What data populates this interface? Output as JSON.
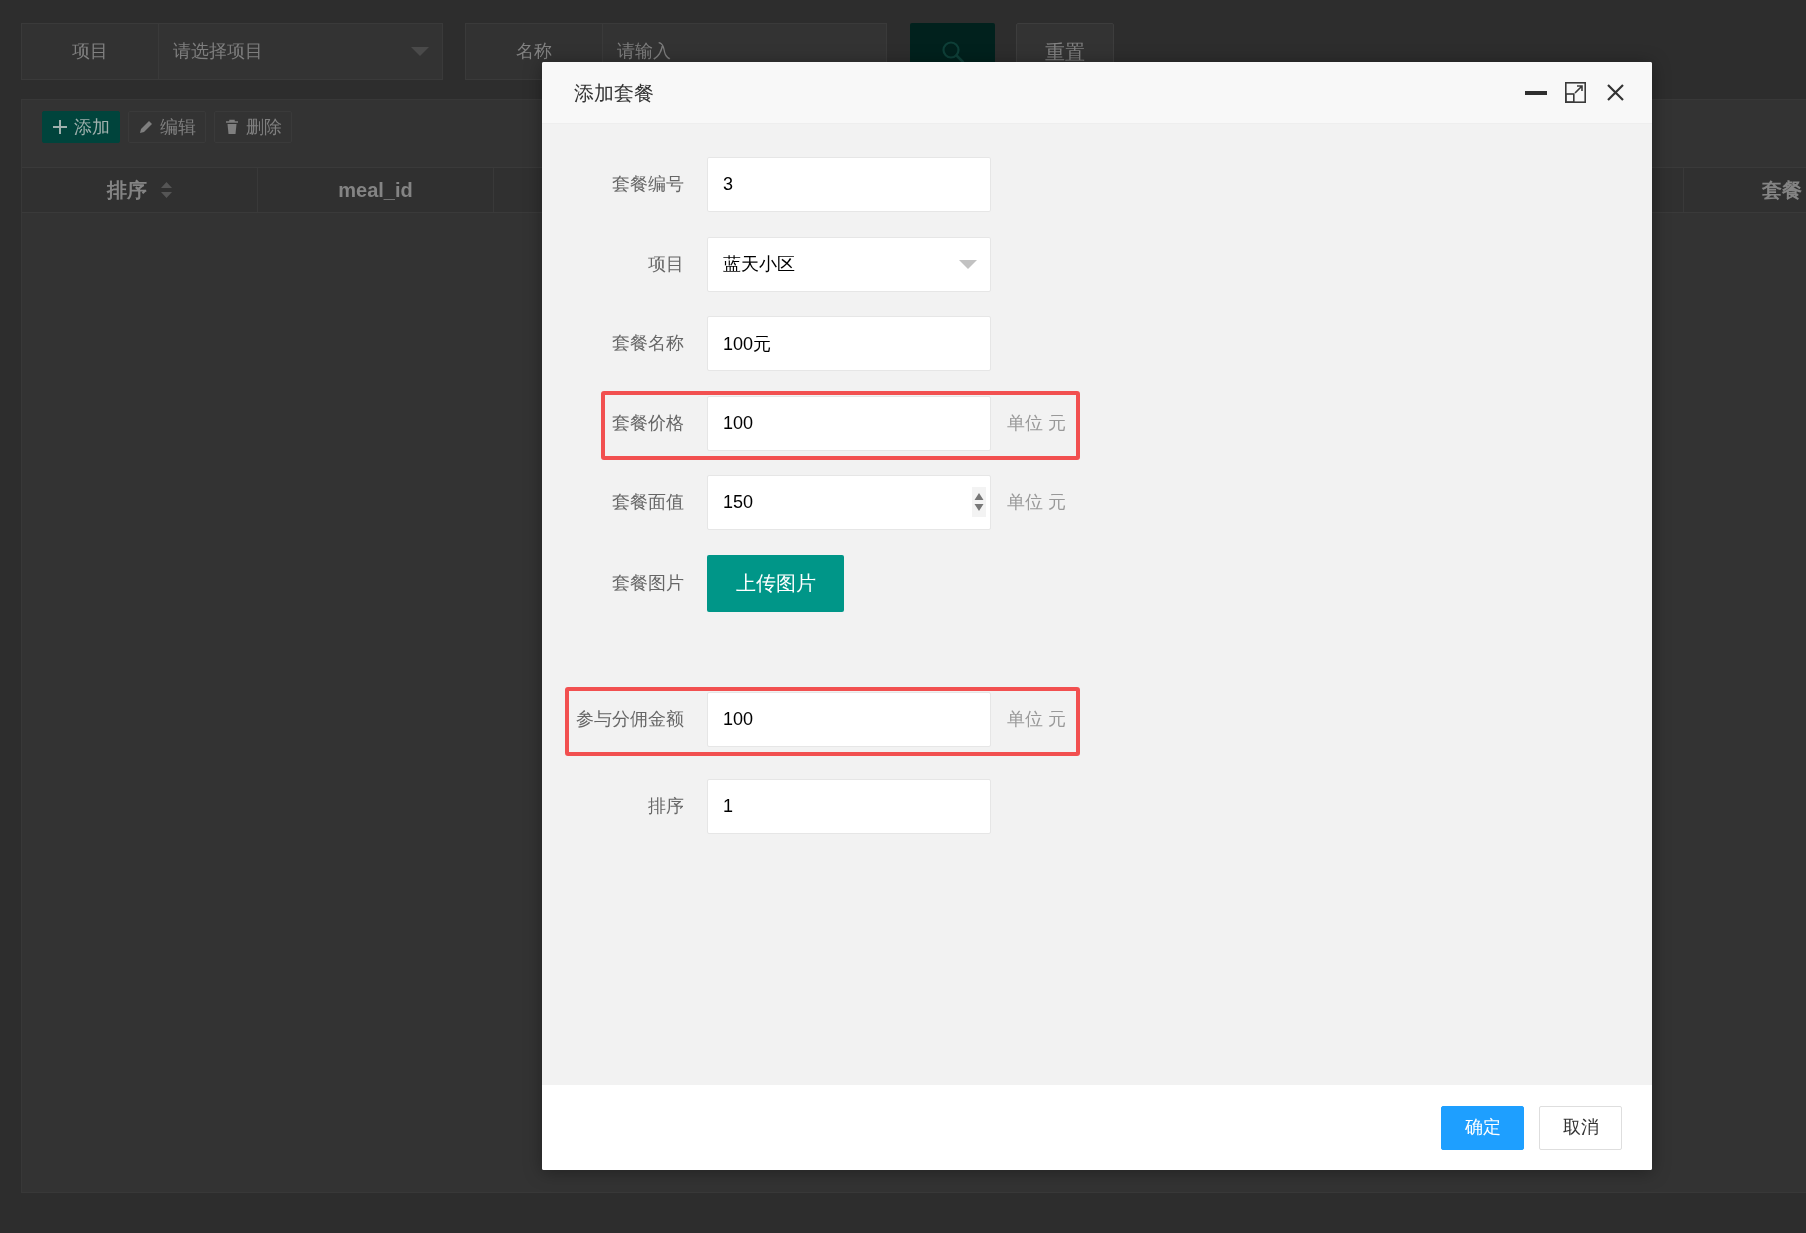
{
  "background_page": {
    "filters": [
      {
        "label": "项目",
        "kind": "select",
        "placeholder": "请选择项目"
      },
      {
        "label": "名称",
        "kind": "input",
        "placeholder": "请输入"
      }
    ],
    "reset_button": "重置",
    "toolbar": [
      {
        "kind": "add",
        "label": "添加",
        "disabled": false
      },
      {
        "kind": "edit",
        "label": "编辑",
        "disabled": true
      },
      {
        "kind": "delete",
        "label": "删除",
        "disabled": true
      }
    ],
    "table": {
      "columns": [
        {
          "label": "排序",
          "sortable": true
        },
        {
          "label": "meal_id",
          "sortable": false
        },
        {
          "label": "套餐",
          "sortable": false
        }
      ]
    }
  },
  "dialog": {
    "title": "添加套餐",
    "fields": [
      {
        "label": "套餐编号",
        "kind": "text",
        "value": "3",
        "highlighted": false
      },
      {
        "label": "项目",
        "kind": "select",
        "value": "蓝天小区",
        "highlighted": false
      },
      {
        "label": "套餐名称",
        "kind": "text",
        "value": "100元",
        "highlighted": false
      },
      {
        "label": "套餐价格",
        "kind": "text",
        "value": "100",
        "unit": "单位 元",
        "highlighted": true
      },
      {
        "label": "套餐面值",
        "kind": "number",
        "value": "150",
        "unit": "单位 元",
        "highlighted": false
      },
      {
        "label": "套餐图片",
        "kind": "upload",
        "button": "上传图片",
        "highlighted": false
      },
      {
        "label": "参与分佣金额",
        "kind": "text",
        "value": "100",
        "unit": "单位 元",
        "highlighted": true
      },
      {
        "label": "排序",
        "kind": "text",
        "value": "1",
        "highlighted": false
      }
    ],
    "buttons": [
      {
        "label": "确定",
        "primary": true
      },
      {
        "label": "取消",
        "primary": false
      }
    ]
  }
}
